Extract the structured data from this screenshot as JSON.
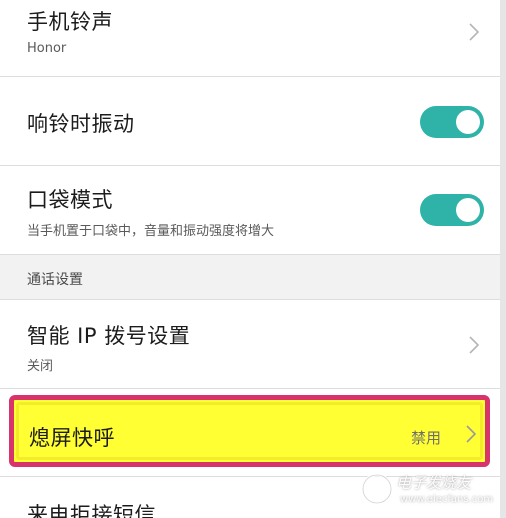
{
  "settings": {
    "ringtone": {
      "title": "手机铃声",
      "value": "Honor"
    },
    "vibrate_on_ring": {
      "title": "响铃时振动",
      "enabled": true
    },
    "pocket_mode": {
      "title": "口袋模式",
      "description": "当手机置于口袋中，音量和振动强度将增大",
      "enabled": true
    },
    "call_settings_header": "通话设置",
    "smart_ip_dialing": {
      "title": "智能 IP 拨号设置",
      "value": "关闭"
    },
    "screen_off_quick_call": {
      "title": "熄屏快呼",
      "value": "禁用"
    },
    "reject_sms": {
      "title": "来电拒接短信"
    }
  },
  "watermark": {
    "text": "电子发烧友",
    "url": "www.elecfans.com"
  },
  "colors": {
    "toggle_on": "#2fb3a8",
    "highlight_fill": "#ffff33",
    "highlight_border": "#d8336b"
  }
}
